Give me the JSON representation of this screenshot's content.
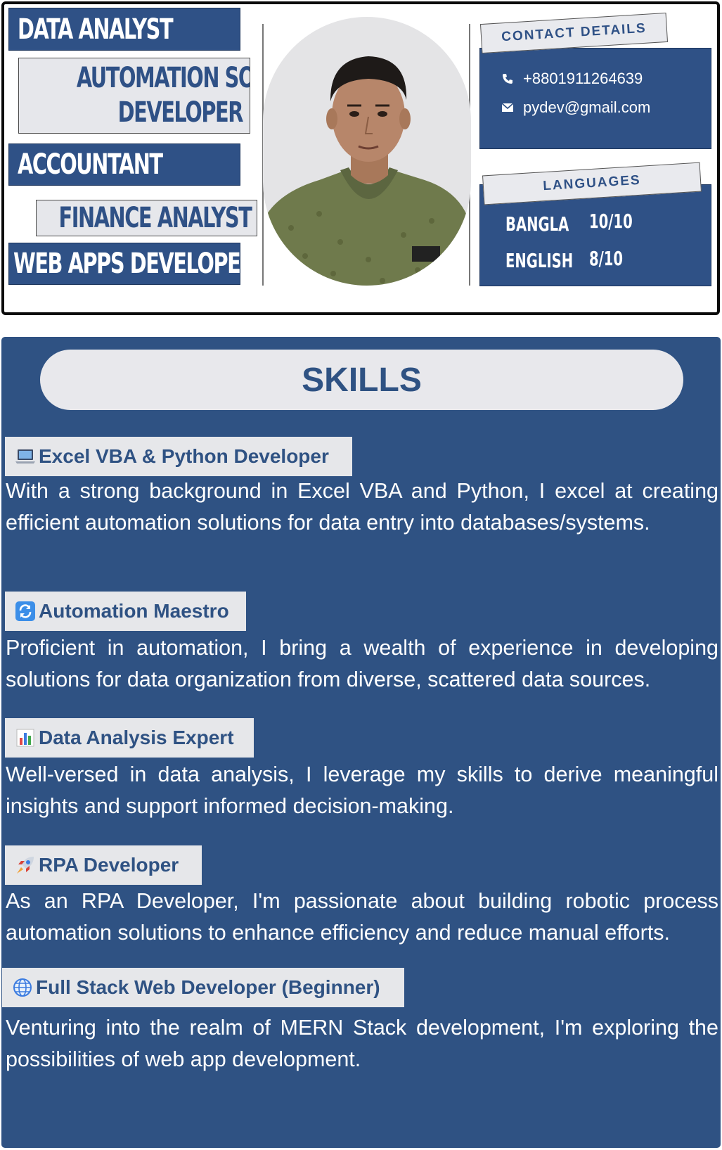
{
  "roles": {
    "data_analyst": "DATA ANALYST",
    "automation_line1": "AUTOMATION SOLUTION",
    "automation_line2": "DEVELOPER",
    "accountant": "ACCOUNTANT",
    "finance": "FINANCE ANALYST",
    "web_apps": "WEB APPS DEVELOPER"
  },
  "contact": {
    "heading": "CONTACT DETAILS",
    "phone": "+8801911264639",
    "email": "pydev@gmail.com",
    "icons": [
      "phone-icon",
      "mail-icon"
    ]
  },
  "languages": {
    "heading": "LANGUAGES",
    "items": [
      {
        "name": "BANGLA",
        "score": "10/10"
      },
      {
        "name": "ENGLISH",
        "score": "8/10"
      }
    ]
  },
  "skills": {
    "title": "SKILLS",
    "items": [
      {
        "icon": "laptop-icon",
        "label": "Excel VBA & Python Developer",
        "desc": "With a strong background in Excel VBA and Python, I excel at creating efficient automation solutions for data entry into databases/systems."
      },
      {
        "icon": "refresh-icon",
        "label": "Automation Maestro",
        "desc": "Proficient in automation, I bring a wealth of experience in developing solutions for data organization from diverse, scattered data sources."
      },
      {
        "icon": "bar-chart-icon",
        "label": "Data Analysis Expert",
        "desc": "Well-versed in data analysis, I leverage my skills to derive meaningful insights and support informed decision-making."
      },
      {
        "icon": "rocket-icon",
        "label": "RPA Developer",
        "desc": "As an RPA Developer, I'm passionate about building robotic process automation solutions to enhance efficiency and reduce manual efforts."
      },
      {
        "icon": "globe-icon",
        "label": "Full Stack Web Developer (Beginner)",
        "desc": "Venturing into the realm of MERN Stack development, I'm exploring the possibilities of web app development."
      }
    ]
  },
  "colors": {
    "navy": "#2f5186",
    "light": "#e6e7eb"
  }
}
